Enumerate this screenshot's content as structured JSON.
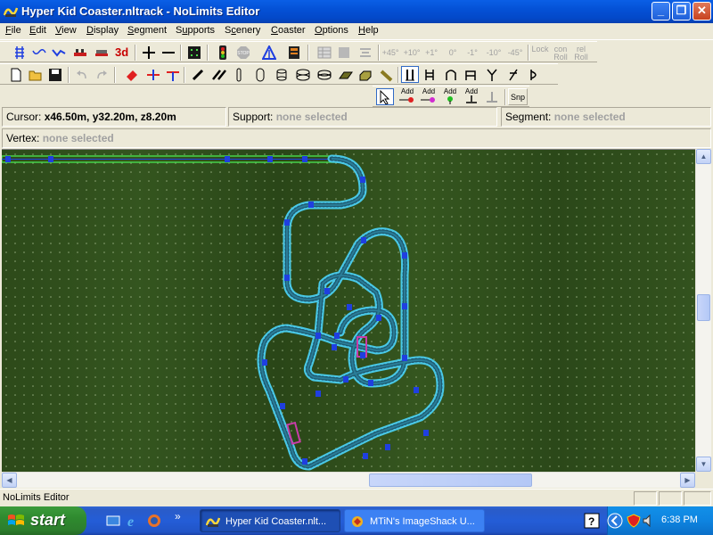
{
  "window": {
    "title": "Hyper Kid Coaster.nltrack - NoLimits Editor",
    "controls": {
      "minimize": "_",
      "maximize": "❐",
      "close": "✕"
    }
  },
  "menu": {
    "items": [
      "File",
      "Edit",
      "View",
      "Display",
      "Segment",
      "Supports",
      "Scenery",
      "Coaster",
      "Options",
      "Help"
    ],
    "underline": [
      "F",
      "E",
      "V",
      "D",
      "S",
      "u",
      "c",
      "C",
      "O",
      "H"
    ]
  },
  "toolbar1": {
    "label_3d": "3d",
    "bank_buttons": [
      "+45°",
      "+10°",
      "+1°",
      "0°",
      "-1°",
      "-10°",
      "-45°"
    ],
    "lock_label": "Lock",
    "con_roll": "con\nRoll",
    "rel_roll": "rel\nRoll"
  },
  "toolbar3": {
    "add_labels": [
      "Add",
      "Add",
      "Add",
      "Add"
    ],
    "snap_label": "Snp"
  },
  "info": {
    "cursor_label": "Cursor:",
    "cursor_value": "x46.50m, y32.20m, z8.20m",
    "support_label": "Support:",
    "support_value": "none selected",
    "segment_label": "Segment:",
    "segment_value": "none selected",
    "vertex_label": "Vertex:",
    "vertex_value": "none selected"
  },
  "colors": {
    "grass": "#2f4a1c",
    "track": "#49c8e6",
    "node": "#1f3fe0",
    "selected_track": "#46d24a",
    "support": "#c83ca8"
  },
  "status": {
    "text": "NoLimits Editor"
  },
  "taskbar": {
    "start": "start",
    "tasks": [
      {
        "label": "Hyper Kid Coaster.nlt...",
        "active": true
      },
      {
        "label": "MTiN's ImageShack U...",
        "active": false
      }
    ],
    "overflow": "»",
    "clock": "6:38 PM"
  }
}
